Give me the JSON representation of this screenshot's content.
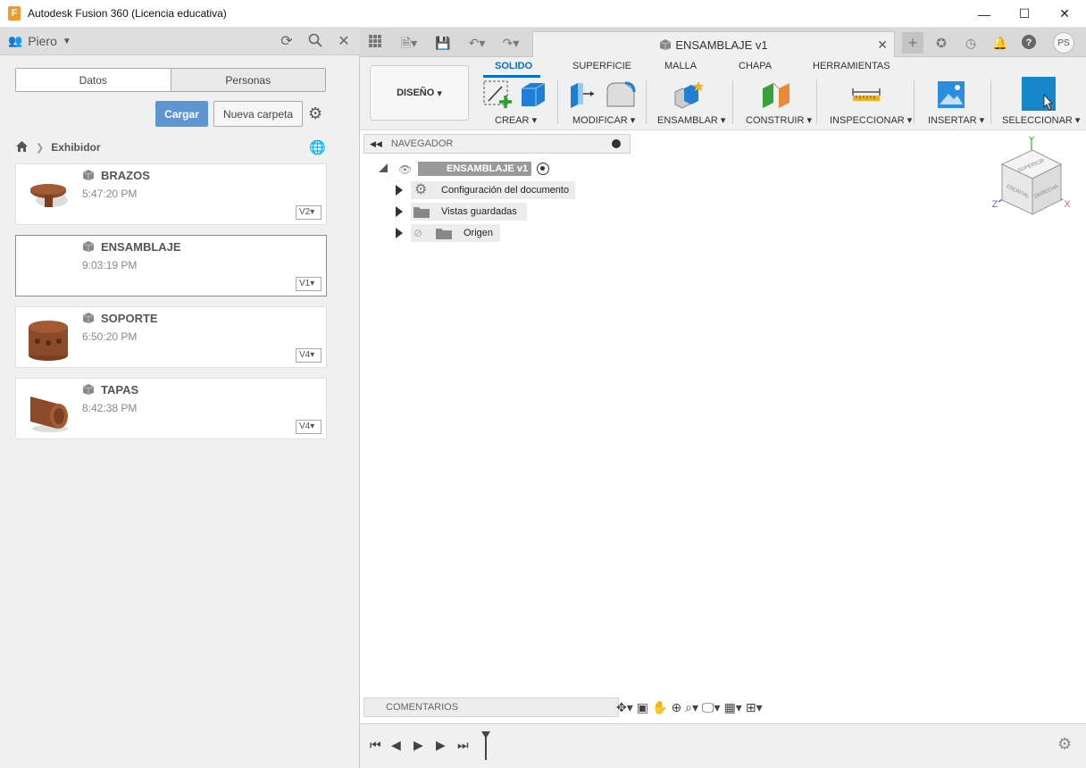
{
  "window": {
    "title": "Autodesk Fusion 360 (Licencia educativa)",
    "logo_letter": "F",
    "min": "—",
    "max": "☐",
    "close": "✕"
  },
  "left_panel": {
    "user": "Piero",
    "tabs": [
      "Datos",
      "Personas"
    ],
    "active_tab": 0,
    "buttons": {
      "upload": "Cargar",
      "new_folder": "Nueva carpeta"
    },
    "breadcrumb": "Exhibidor",
    "files": [
      {
        "name": "BRAZOS",
        "time": "5:47:20 PM",
        "version": "V2"
      },
      {
        "name": "ENSAMBLAJE",
        "time": "9:03:19 PM",
        "version": "V1",
        "selected": true
      },
      {
        "name": "SOPORTE",
        "time": "6:50:20 PM",
        "version": "V4"
      },
      {
        "name": "TAPAS",
        "time": "8:42:38 PM",
        "version": "V4"
      }
    ]
  },
  "document_tab": {
    "title": "ENSAMBLAJE v1"
  },
  "user_initials": "PS",
  "ribbon": {
    "workspace": "DISEÑO",
    "tabs": [
      "SOLIDO",
      "SUPERFICIE",
      "MALLA",
      "CHAPA",
      "HERRAMIENTAS"
    ],
    "active_tab": "SOLIDO",
    "groups": [
      "CREAR",
      "MODIFICAR",
      "ENSAMBLAR",
      "CONSTRUIR",
      "INSPECCIONAR",
      "INSERTAR",
      "SELECCIONAR"
    ]
  },
  "navigator": {
    "title": "NAVEGADOR",
    "root": "ENSAMBLAJE v1",
    "nodes": [
      "Configuración del documento",
      "Vistas guardadas",
      "Origen"
    ]
  },
  "viewcube": {
    "top": "SUPERIOR",
    "front": "FRONTAL",
    "right": "DERECHA",
    "x": "X",
    "y": "Y",
    "z": "Z"
  },
  "comments": "COMENTARIOS",
  "colors": {
    "accent": "#0a6ec4",
    "upload_button": "#5e95d2",
    "select_icon": "#1587c9"
  }
}
